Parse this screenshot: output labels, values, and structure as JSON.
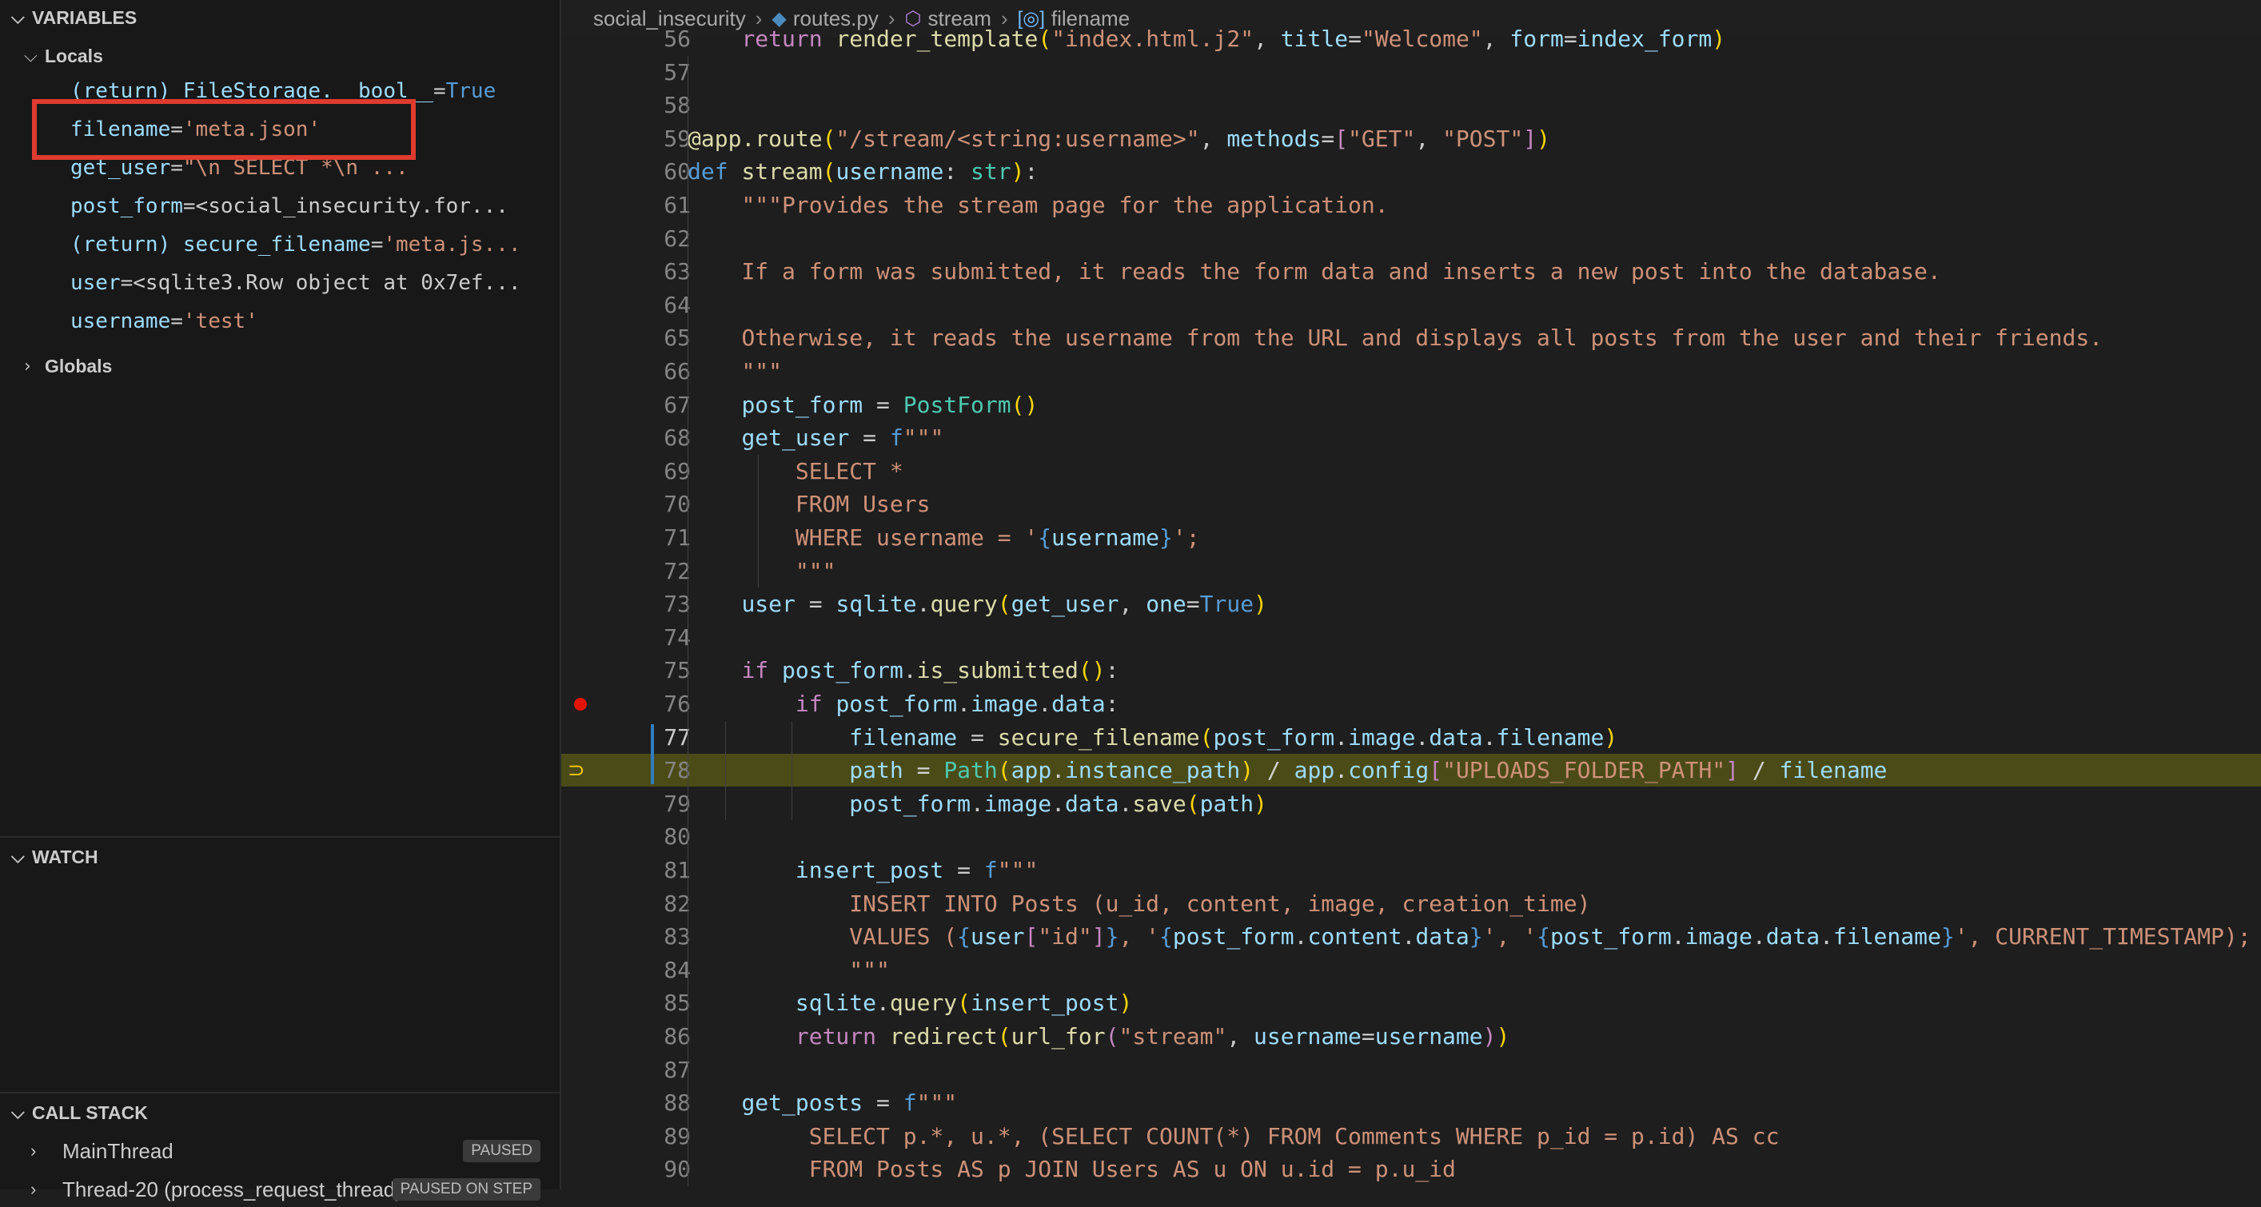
{
  "sidebar": {
    "variables_header": "VARIABLES",
    "locals_label": "Locals",
    "globals_label": "Globals",
    "locals": [
      {
        "name": "(return) FileStorage.__bool__",
        "eq": " = ",
        "value": "True",
        "kind": "bool",
        "expandable": false
      },
      {
        "name": "filename",
        "eq": " = ",
        "value": "'meta.json'",
        "kind": "str",
        "expandable": false
      },
      {
        "name": "get_user",
        "eq": " = ",
        "value": "\"\\n        SELECT *\\n    ...",
        "kind": "str",
        "expandable": false
      },
      {
        "name": "post_form",
        "eq": " = ",
        "value": "<social_insecurity.for...",
        "kind": "obj",
        "expandable": true
      },
      {
        "name": "(return) secure_filename",
        "eq": " = ",
        "value": "'meta.js...",
        "kind": "str",
        "expandable": false
      },
      {
        "name": "user",
        "eq": " = ",
        "value": "<sqlite3.Row object at 0x7ef...",
        "kind": "obj",
        "expandable": true
      },
      {
        "name": "username",
        "eq": " = ",
        "value": "'test'",
        "kind": "str",
        "expandable": false
      }
    ],
    "watch_header": "WATCH",
    "callstack_header": "CALL STACK",
    "threads": [
      {
        "name": "MainThread",
        "status": "PAUSED"
      },
      {
        "name": "Thread-20 (process_request_thread)",
        "status": "PAUSED ON STEP"
      }
    ]
  },
  "breadcrumbs": {
    "folder": "social_insecurity",
    "file": "routes.py",
    "function": "stream",
    "symbol": "filename"
  },
  "editor": {
    "current_line": 78,
    "active_line": 77,
    "breakpoint_line": 76,
    "lines": [
      {
        "n": "56",
        "html": "    <span class='kw'>return</span> <span class='fn'>render_template</span><span class='pn'>(</span><span class='str'>\"index.html.j2\"</span>, <span class='var2'>title</span>=<span class='str'>\"Welcome\"</span>, <span class='var2'>form</span>=<span class='var2'>index_form</span><span class='pn'>)</span>"
      },
      {
        "n": "57",
        "html": ""
      },
      {
        "n": "58",
        "html": ""
      },
      {
        "n": "59",
        "html": "<span class='fn'>@app.route</span><span class='pn'>(</span><span class='str'>\"/stream/&lt;string:username&gt;\"</span>, <span class='var2'>methods</span>=<span class='kw'>[</span><span class='str'>\"GET\"</span>, <span class='str'>\"POST\"</span><span class='kw'>]</span><span class='pn'>)</span>"
      },
      {
        "n": "60",
        "html": "<span class='kw2'>def</span> <span class='fn'>stream</span><span class='pn'>(</span><span class='var2'>username</span>: <span class='cls'>str</span><span class='pn'>)</span>:"
      },
      {
        "n": "61",
        "html": "    <span class='str'>\"\"\"Provides the stream page for the application.</span>"
      },
      {
        "n": "62",
        "html": ""
      },
      {
        "n": "63",
        "html": "    <span class='str'>If a form was submitted, it reads the form data and inserts a new post into the database.</span>"
      },
      {
        "n": "64",
        "html": ""
      },
      {
        "n": "65",
        "html": "    <span class='str'>Otherwise, it reads the username from the URL and displays all posts from the user and their friends.</span>"
      },
      {
        "n": "66",
        "html": "    <span class='str'>\"\"\"</span>"
      },
      {
        "n": "67",
        "html": "    <span class='var2'>post_form</span> = <span class='cls'>PostForm</span><span class='pn'>()</span>"
      },
      {
        "n": "68",
        "html": "    <span class='var2'>get_user</span> = <span class='kw2'>f</span><span class='str'>\"\"\"</span>"
      },
      {
        "n": "69",
        "html": "        <span class='str'>SELECT *</span>"
      },
      {
        "n": "70",
        "html": "        <span class='str'>FROM Users</span>"
      },
      {
        "n": "71",
        "html": "        <span class='str'>WHERE username = '</span><span class='kw2'>{</span><span class='var2'>username</span><span class='kw2'>}</span><span class='str'>';</span>"
      },
      {
        "n": "72",
        "html": "        <span class='str'>\"\"\"</span>"
      },
      {
        "n": "73",
        "html": "    <span class='var2'>user</span> = <span class='var2'>sqlite</span>.<span class='fn'>query</span><span class='pn'>(</span><span class='var2'>get_user</span>, <span class='var2'>one</span>=<span class='kw2'>True</span><span class='pn'>)</span>"
      },
      {
        "n": "74",
        "html": ""
      },
      {
        "n": "75",
        "html": "    <span class='kw'>if</span> <span class='var2'>post_form</span>.<span class='fn'>is_submitted</span><span class='pn'>()</span>:"
      },
      {
        "n": "76",
        "html": "        <span class='kw'>if</span> <span class='var2'>post_form</span>.<span class='var2'>image</span>.<span class='var2'>data</span>:"
      },
      {
        "n": "77",
        "html": "            <span class='var2'>filename</span> = <span class='fn'>secure_filename</span><span class='pn'>(</span><span class='var2'>post_form</span>.<span class='var2'>image</span>.<span class='var2'>data</span>.<span class='var2'>filename</span><span class='pn'>)</span>"
      },
      {
        "n": "78",
        "html": "            <span class='var2'>path</span> = <span class='cls'>Path</span><span class='pn'>(</span><span class='var2'>app</span>.<span class='var2'>instance_path</span><span class='pn'>)</span> / <span class='var2'>app</span>.<span class='var2'>config</span><span class='kw'>[</span><span class='str'>\"UPLOADS_FOLDER_PATH\"</span><span class='kw'>]</span> / <span class='var2'>filename</span>"
      },
      {
        "n": "79",
        "html": "            <span class='var2'>post_form</span>.<span class='var2'>image</span>.<span class='var2'>data</span>.<span class='fn'>save</span><span class='pn'>(</span><span class='var2'>path</span><span class='pn'>)</span>"
      },
      {
        "n": "80",
        "html": ""
      },
      {
        "n": "81",
        "html": "        <span class='var2'>insert_post</span> = <span class='kw2'>f</span><span class='str'>\"\"\"</span>"
      },
      {
        "n": "82",
        "html": "            <span class='str'>INSERT INTO Posts (u_id, content, image, creation_time)</span>"
      },
      {
        "n": "83",
        "html": "            <span class='str'>VALUES (</span><span class='kw2'>{</span><span class='var2'>user</span><span class='kw'>[</span><span class='str'>\"id\"</span><span class='kw'>]</span><span class='kw2'>}</span><span class='str'>, '</span><span class='kw2'>{</span><span class='var2'>post_form</span>.<span class='var2'>content</span>.<span class='var2'>data</span><span class='kw2'>}</span><span class='str'>', '</span><span class='kw2'>{</span><span class='var2'>post_form</span>.<span class='var2'>image</span>.<span class='var2'>data</span>.<span class='var2'>filename</span><span class='kw2'>}</span><span class='str'>', CURRENT_TIMESTAMP);</span>"
      },
      {
        "n": "84",
        "html": "            <span class='str'>\"\"\"</span>"
      },
      {
        "n": "85",
        "html": "        <span class='var2'>sqlite</span>.<span class='fn'>query</span><span class='pn'>(</span><span class='var2'>insert_post</span><span class='pn'>)</span>"
      },
      {
        "n": "86",
        "html": "        <span class='kw'>return</span> <span class='fn'>redirect</span><span class='pn'>(</span><span class='fn'>url_for</span><span class='kw'>(</span><span class='str'>\"stream\"</span>, <span class='var2'>username</span>=<span class='var2'>username</span><span class='kw'>)</span><span class='pn'>)</span>"
      },
      {
        "n": "87",
        "html": ""
      },
      {
        "n": "88",
        "html": "    <span class='var2'>get_posts</span> = <span class='kw2'>f</span><span class='str'>\"\"\"</span>"
      },
      {
        "n": "89",
        "html": "         <span class='str'>SELECT p.*, u.*, (SELECT COUNT(*) FROM Comments WHERE p_id = p.id) AS cc</span>"
      },
      {
        "n": "90",
        "html": "         <span class='str'>FROM Posts AS p JOIN Users AS u ON u.id = p.u_id</span>"
      }
    ]
  }
}
